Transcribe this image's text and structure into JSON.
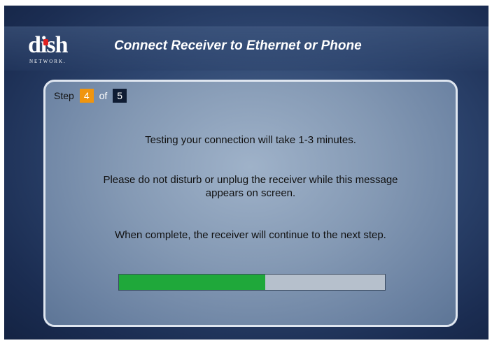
{
  "header": {
    "logo": {
      "word": "dish",
      "subtext": "NETWORK."
    },
    "title": "Connect Receiver to Ethernet or Phone"
  },
  "step": {
    "label": "Step",
    "current": "4",
    "of_label": "of",
    "total": "5"
  },
  "messages": [
    "Testing your connection will take 1-3 minutes.",
    "Please do not disturb or unplug the receiver while this message appears on screen.",
    "When complete, the receiver will continue to the next step."
  ],
  "progress": {
    "fraction": 0.55
  },
  "colors": {
    "step_current_bg": "#f0950e",
    "step_total_bg": "#0f1c33",
    "progress_fill": "#1fa83a",
    "logo_accent": "#e02020"
  }
}
